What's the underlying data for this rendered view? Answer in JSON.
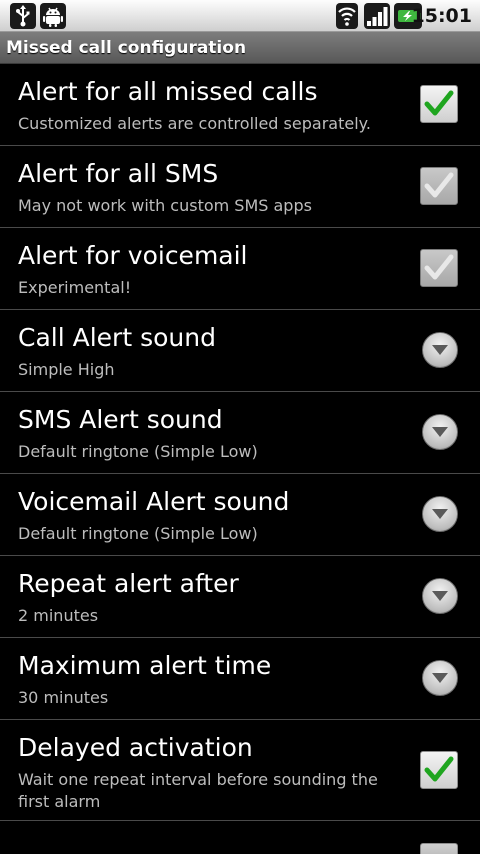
{
  "status_bar": {
    "time": "15:01",
    "left_icons": [
      "usb-icon",
      "android-debug-icon"
    ],
    "right_icons": [
      "wifi-icon",
      "signal-icon",
      "battery-icon"
    ]
  },
  "title_bar": {
    "title": "Missed call configuration"
  },
  "colors": {
    "background": "#000000",
    "title_bar": "#6b6b6b",
    "check_enabled": "#22b022",
    "check_disabled": "#e6e6e6",
    "summary_text": "#bdbdbd"
  },
  "settings": [
    {
      "title": "Alert for all missed calls",
      "summary": "Customized alerts are controlled separately.",
      "control": "checkbox",
      "checked": true,
      "enabled": true
    },
    {
      "title": "Alert for all SMS",
      "summary": "May not work with custom SMS apps",
      "control": "checkbox",
      "checked": true,
      "enabled": false
    },
    {
      "title": "Alert for voicemail",
      "summary": "Experimental!",
      "control": "checkbox",
      "checked": true,
      "enabled": false
    },
    {
      "title": "Call Alert sound",
      "summary": "Simple High",
      "control": "dropdown"
    },
    {
      "title": "SMS Alert sound",
      "summary": "Default ringtone (Simple Low)",
      "control": "dropdown"
    },
    {
      "title": "Voicemail Alert sound",
      "summary": "Default ringtone (Simple Low)",
      "control": "dropdown"
    },
    {
      "title": "Repeat alert after",
      "summary": "2 minutes",
      "control": "dropdown"
    },
    {
      "title": "Maximum alert time",
      "summary": "30 minutes",
      "control": "dropdown"
    },
    {
      "title": "Delayed activation",
      "summary": "Wait one repeat interval before sounding the first alarm",
      "control": "checkbox",
      "checked": true,
      "enabled": true
    }
  ]
}
